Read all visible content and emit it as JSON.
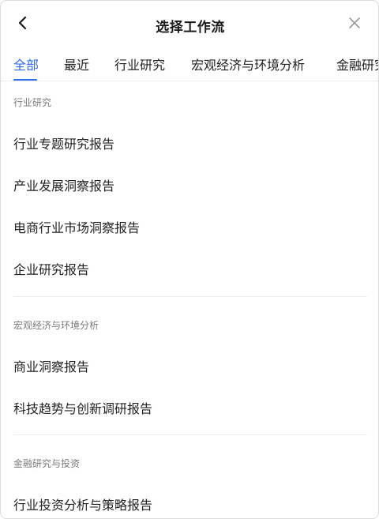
{
  "header": {
    "title": "选择工作流",
    "back_icon": "chevron-left-icon",
    "close_icon": "close-icon"
  },
  "tabs": [
    {
      "label": "全部",
      "active": true
    },
    {
      "label": "最近",
      "active": false
    },
    {
      "label": "行业研究",
      "active": false
    },
    {
      "label": "宏观经济与环境分析",
      "active": false
    },
    {
      "label": "金融研究",
      "active": false
    }
  ],
  "sections": [
    {
      "label": "行业研究",
      "items": [
        "行业专题研究报告",
        "产业发展洞察报告",
        "电商行业市场洞察报告",
        "企业研究报告"
      ]
    },
    {
      "label": "宏观经济与环境分析",
      "items": [
        "商业洞察报告",
        "科技趋势与创新调研报告"
      ]
    },
    {
      "label": "金融研究与投资",
      "items": [
        "行业投资分析与策略报告"
      ]
    }
  ],
  "colors": {
    "accent": "#2f6bea",
    "text": "#222222",
    "muted": "#7a7a7a"
  }
}
